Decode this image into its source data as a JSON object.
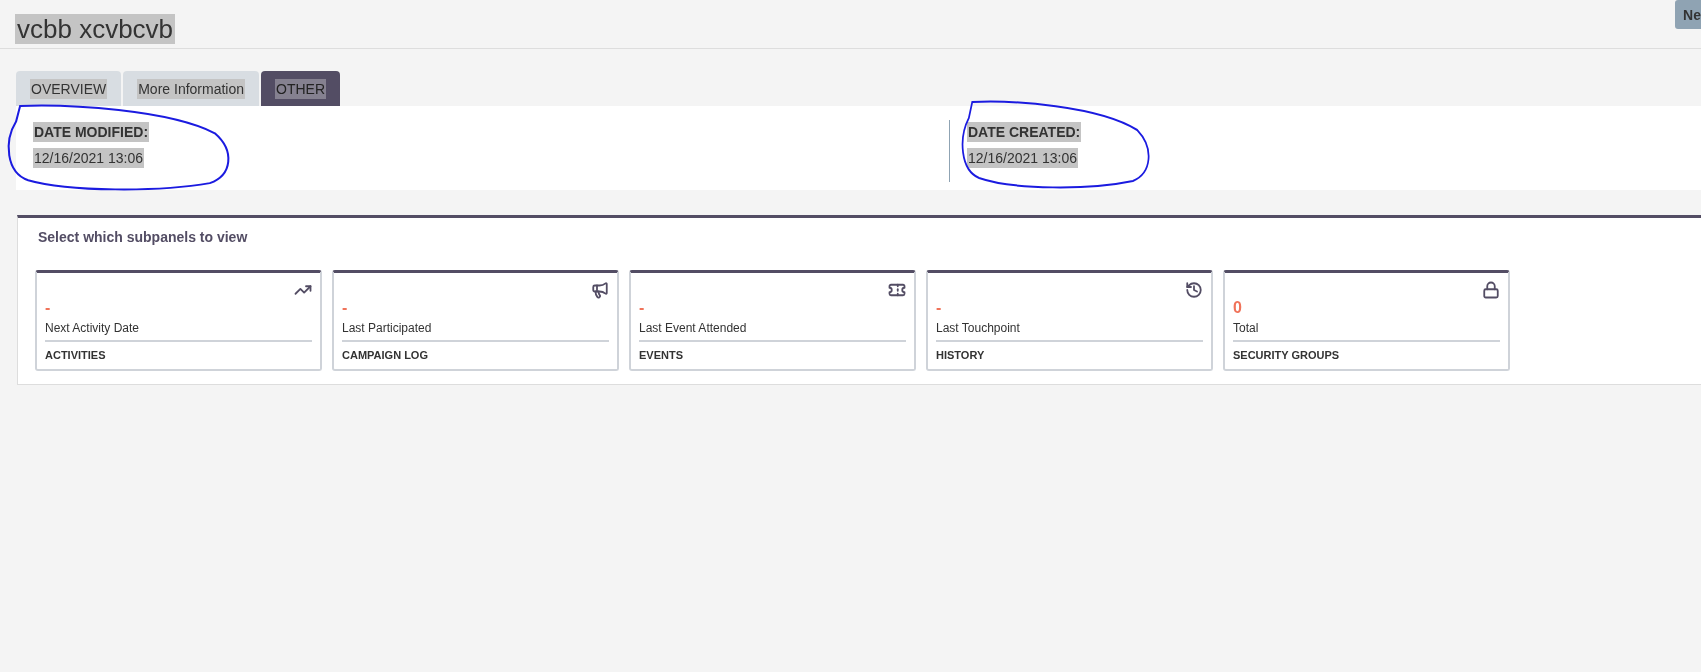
{
  "header": {
    "title": "vcbb xcvbcvb",
    "button": "Ne"
  },
  "tabs": [
    {
      "label": "OVERVIEW",
      "selected": false
    },
    {
      "label": "More Information",
      "selected": false
    },
    {
      "label": "OTHER",
      "selected": true
    }
  ],
  "fields": [
    {
      "label": "DATE MODIFIED:",
      "value": "12/16/2021 13:06"
    },
    {
      "label": "DATE CREATED:",
      "value": "12/16/2021 13:06"
    }
  ],
  "subpanels": {
    "title": "Select which subpanels to view",
    "cards": [
      {
        "kind": "activities",
        "value": "-",
        "caption": "Next Activity Date",
        "name": "ACTIVITIES"
      },
      {
        "kind": "campaign",
        "value": "-",
        "caption": "Last Participated",
        "name": "CAMPAIGN LOG"
      },
      {
        "kind": "events",
        "value": "-",
        "caption": "Last Event Attended",
        "name": "EVENTS"
      },
      {
        "kind": "history",
        "value": "-",
        "caption": "Last Touchpoint",
        "name": "HISTORY"
      },
      {
        "kind": "security",
        "value": "0",
        "caption": "Total",
        "name": "SECURITY GROUPS"
      }
    ]
  }
}
